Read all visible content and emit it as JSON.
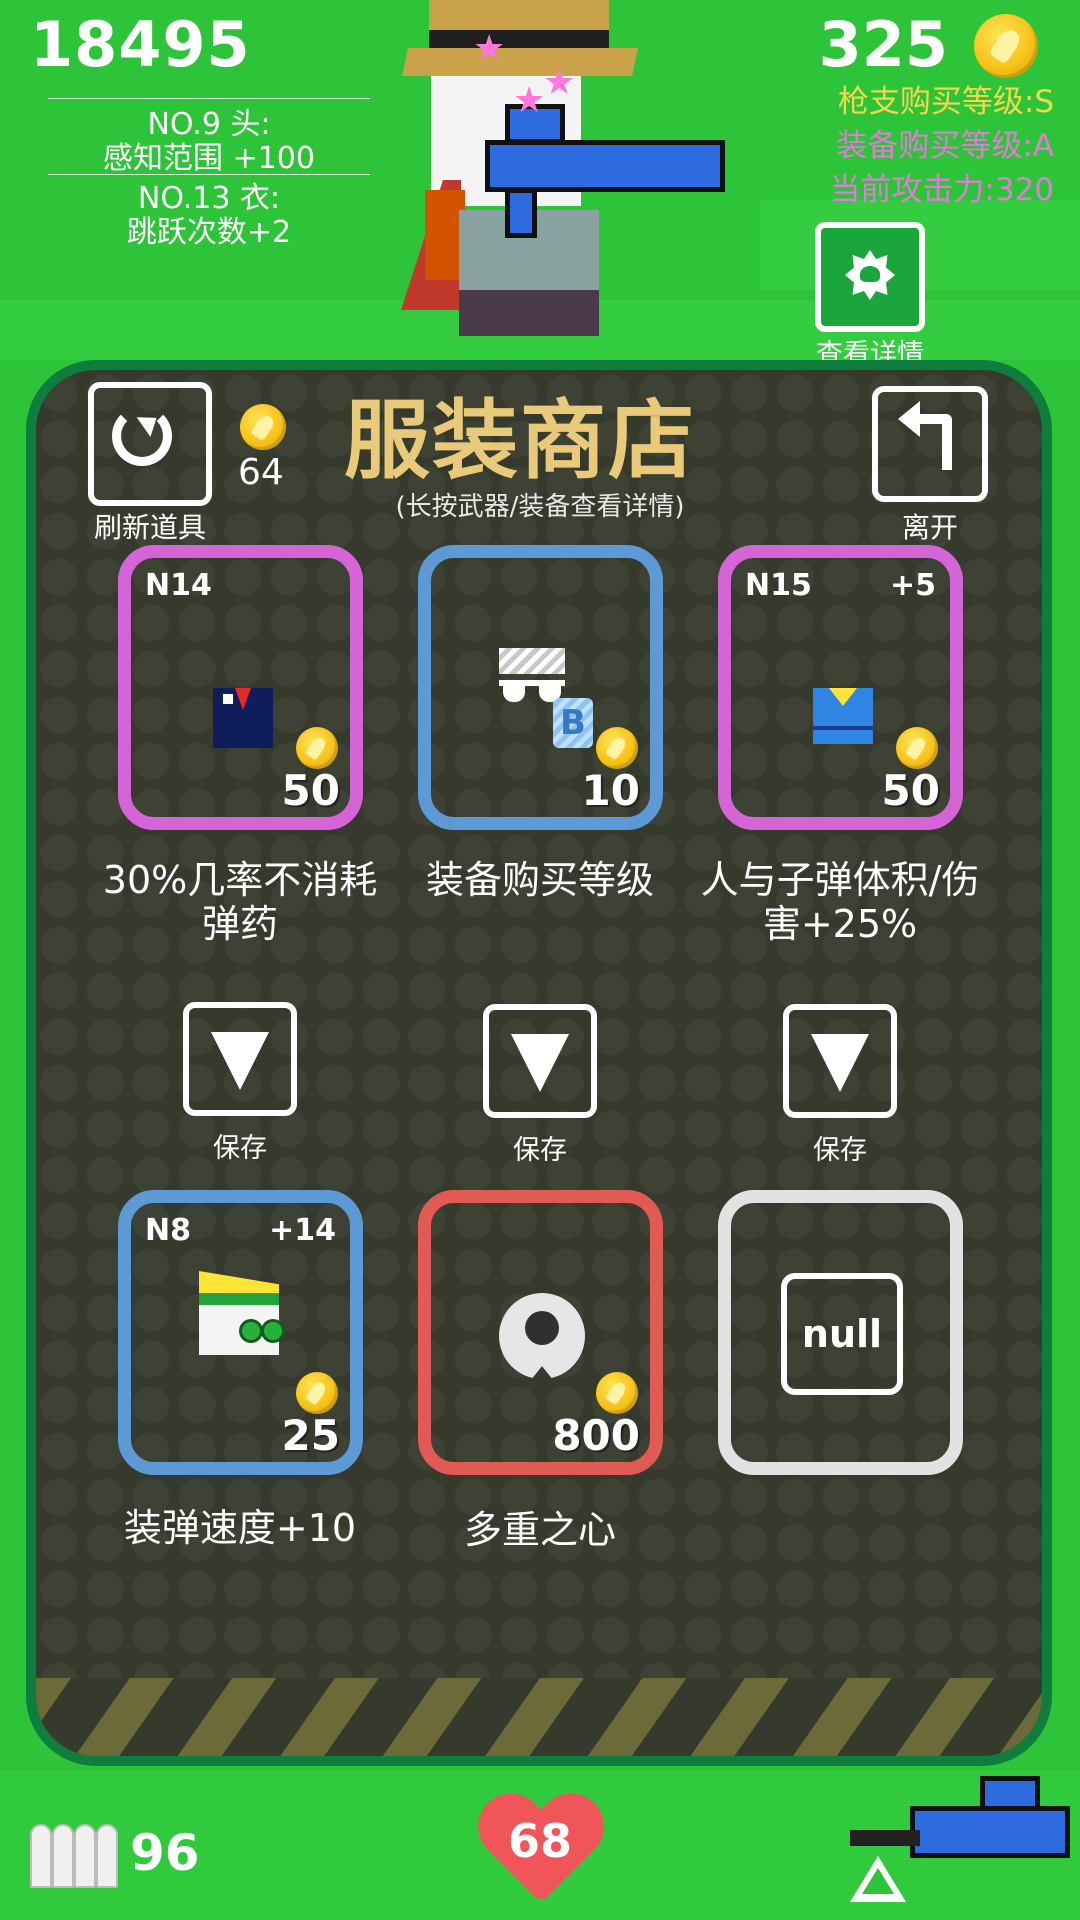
{
  "hud": {
    "score": "18495",
    "coins": "325",
    "equipped": [
      {
        "line1": "NO.9 头:",
        "line2": "感知范围 +100"
      },
      {
        "line1": "NO.13 衣:",
        "line2": "跳跃次数+2"
      }
    ],
    "gun_level": "枪支购买等级:S",
    "equip_level": "装备购买等级:A",
    "attack_power": "当前攻击力:320",
    "details_label": "查看详情",
    "ammo": "96",
    "health": "68"
  },
  "shop": {
    "title": "服装商店",
    "subtitle": "(长按武器/装备查看详情)",
    "refresh_label": "刷新道具",
    "refresh_cost": "64",
    "leave_label": "离开",
    "save_label": "保存",
    "items": [
      {
        "code": "N14",
        "plus": "",
        "price": "50",
        "desc": "30%几率不消耗弹药",
        "rarity": "pink",
        "icon": "suit-icon"
      },
      {
        "code": "",
        "plus": "",
        "price": "10",
        "desc": "装备购买等级",
        "rarity": "blue",
        "icon": "glasses-icon"
      },
      {
        "code": "N15",
        "plus": "+5",
        "price": "50",
        "desc": "人与子弹体积/伤害+25%",
        "rarity": "pink",
        "icon": "shirt-icon"
      },
      {
        "code": "N8",
        "plus": "+14",
        "price": "25",
        "desc": "装弹速度+10",
        "rarity": "blue",
        "icon": "hat-icon"
      },
      {
        "code": "",
        "plus": "",
        "price": "800",
        "desc": "多重之心",
        "rarity": "red",
        "icon": "heart-item-icon"
      },
      {
        "code": "",
        "plus": "",
        "price": "",
        "desc": "",
        "rarity": "white",
        "icon": "null-icon",
        "placeholder": "null"
      }
    ]
  },
  "colors": {
    "background": "#2ec43a",
    "panel": "#353a2d",
    "title": "#e9c97a",
    "pink": "#d565d6",
    "blue": "#5d99d5",
    "red": "#e25a54",
    "heart": "#f0555a",
    "coin": "#f7c318"
  }
}
